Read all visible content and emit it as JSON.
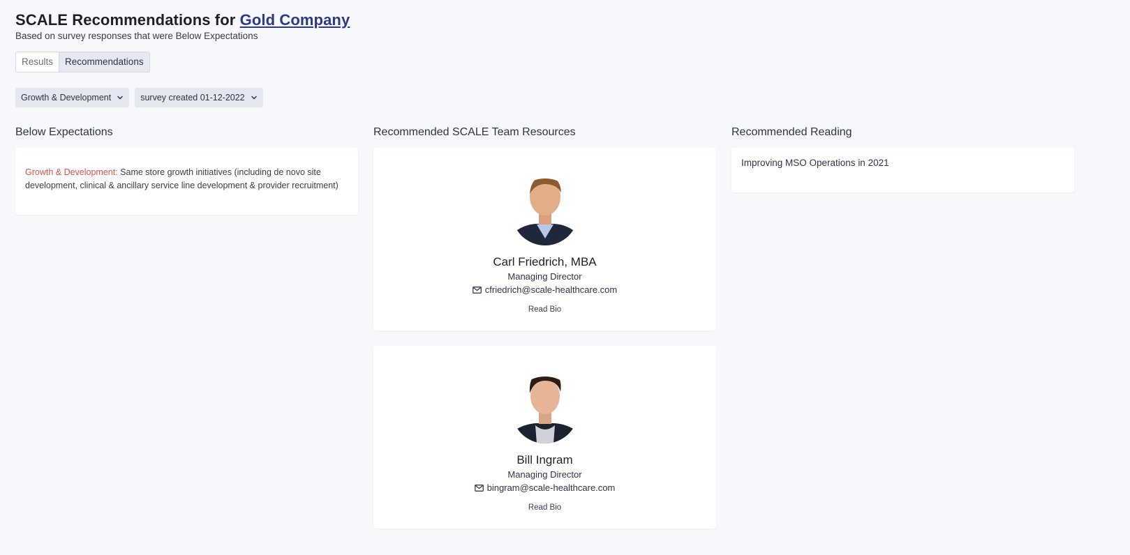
{
  "header": {
    "title_prefix": "SCALE Recommendations for ",
    "company_link": "Gold Company",
    "subtitle": "Based on survey responses that were Below Expectations"
  },
  "tabs": [
    {
      "label": "Results",
      "active": false
    },
    {
      "label": "Recommendations",
      "active": true
    }
  ],
  "filters": {
    "category": "Growth & Development",
    "survey": "survey created 01-12-2022"
  },
  "below": {
    "title": "Below Expectations",
    "category": "Growth & Development:",
    "text": " Same store growth initiatives (including de novo site development, clinical & ancillary service line development & provider recruitment)"
  },
  "resources": {
    "title": "Recommended SCALE Team Resources",
    "people": [
      {
        "name": "Carl Friedrich, MBA",
        "role": "Managing Director",
        "email": "cfriedrich@scale-healthcare.com",
        "bio_label": "Read Bio"
      },
      {
        "name": "Bill Ingram",
        "role": "Managing Director",
        "email": "bingram@scale-healthcare.com",
        "bio_label": "Read Bio"
      }
    ]
  },
  "reading": {
    "title": "Recommended Reading",
    "items": [
      "Improving MSO Operations in 2021"
    ]
  },
  "colors": {
    "accent": "#2d3a8c",
    "category_red": "#d9534f",
    "background": "#f7f8fb"
  }
}
